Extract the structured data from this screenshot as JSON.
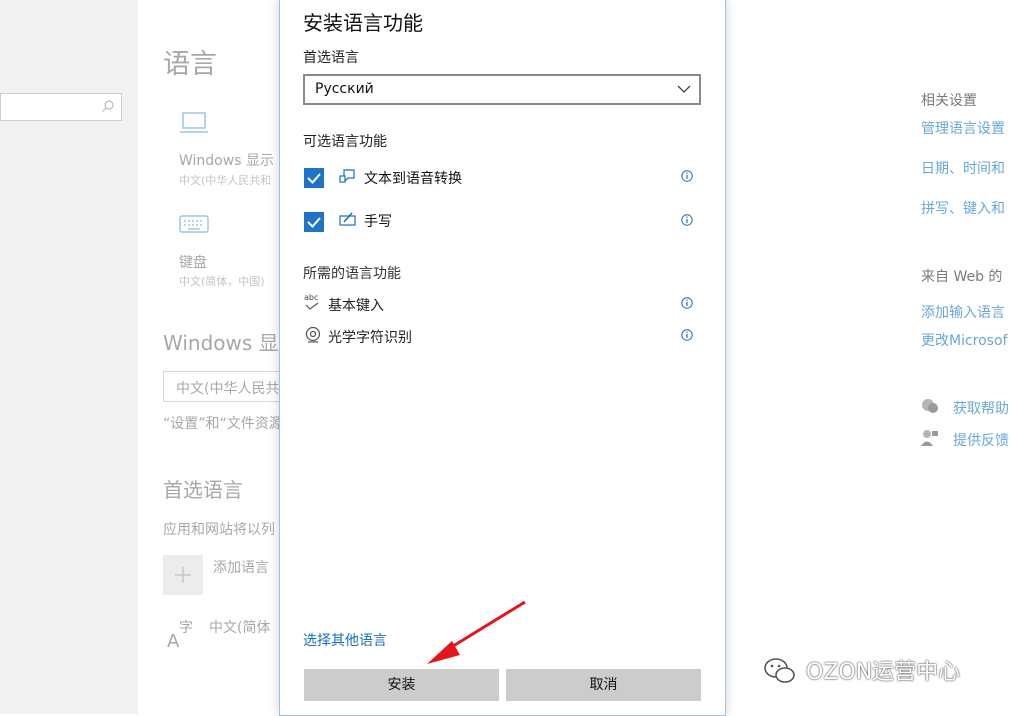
{
  "background": {
    "page_title": "语言",
    "windows_display": "Windows 显示",
    "windows_display_sub": "中文(中华人民共和",
    "keyboard": "键盘",
    "keyboard_sub": "中文(简体，中国)",
    "windows_display_lang_heading": "Windows 显示",
    "windows_display_lang_value": "中文(中华人民共",
    "windows_display_note": "“设置”和“文件资源",
    "preferred_heading": "首选语言",
    "preferred_desc": "应用和网站将以列",
    "add_language": "添加语言",
    "chinese_simplified": "中文(简体",
    "related_settings": "相关设置",
    "manage_language": "管理语言设置",
    "date_time": "日期、时间和",
    "spelling": "拼写、键入和",
    "from_web": "来自 Web 的",
    "add_input": "添加输入语言",
    "change_microsoft": "更改Microsof",
    "get_help": "获取帮助",
    "feedback": "提供反馈"
  },
  "dialog": {
    "title": "安装语言功能",
    "preferred_label": "首选语言",
    "selected_language": "Русский",
    "optional_heading": "可选语言功能",
    "optional_features": [
      {
        "label": "文本到语音转换",
        "checked": true
      },
      {
        "label": "手写",
        "checked": true
      }
    ],
    "required_heading": "所需的语言功能",
    "required_features": [
      {
        "label": "基本键入",
        "icon_text": "abc"
      },
      {
        "label": "光学字符识别"
      }
    ],
    "other_language_link": "选择其他语言",
    "install_label": "安装",
    "cancel_label": "取消"
  },
  "watermark": "OZON运营中心",
  "colors": {
    "accent": "#1f74c8",
    "link": "#1a6fc4",
    "arrow": "#e8141b"
  }
}
